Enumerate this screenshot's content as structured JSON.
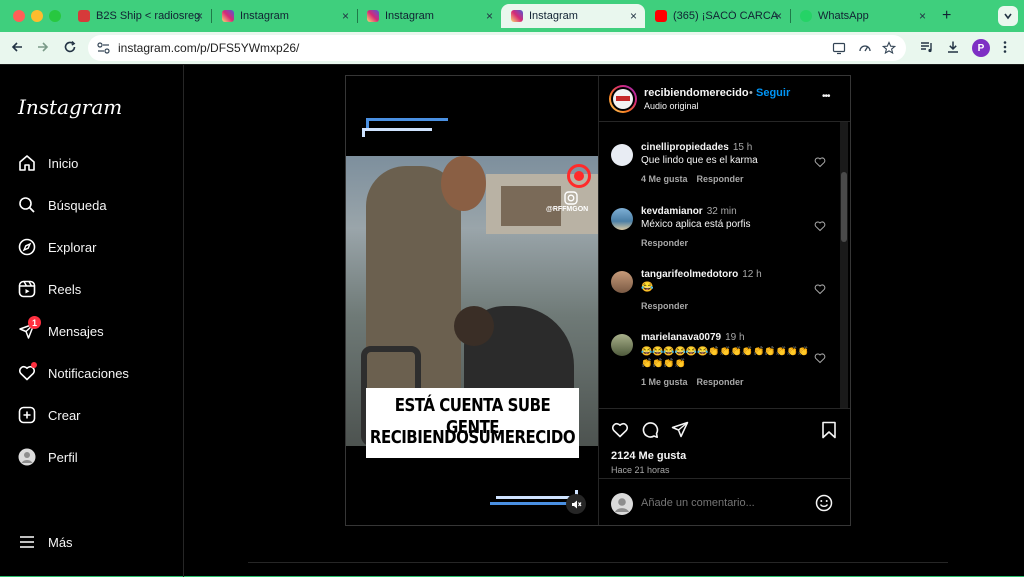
{
  "browser": {
    "tabs": [
      {
        "label": "B2S Ship < radiosreg",
        "favicon_color": "#d63a3a"
      },
      {
        "label": "Instagram",
        "favicon_color": "#d62976"
      },
      {
        "label": "Instagram",
        "favicon_color": "#d62976"
      },
      {
        "label": "Instagram",
        "favicon_color": "#d62976",
        "active": true
      },
      {
        "label": "(365) ¡SACÓ CARCA",
        "favicon_color": "#ff0000"
      },
      {
        "label": "WhatsApp",
        "favicon_color": "#25d366"
      }
    ],
    "new_tab": "+",
    "close_glyph": "×",
    "url": "instagram.com/p/DFS5YWmxp26/",
    "profile_initial": "P"
  },
  "sidebar": {
    "logo": "Instagram",
    "items": [
      {
        "label": "Inicio",
        "icon": "home-icon"
      },
      {
        "label": "Búsqueda",
        "icon": "search-icon"
      },
      {
        "label": "Explorar",
        "icon": "compass-icon"
      },
      {
        "label": "Reels",
        "icon": "reels-icon"
      },
      {
        "label": "Mensajes",
        "icon": "messenger-icon",
        "badge": "1"
      },
      {
        "label": "Notificaciones",
        "icon": "heart-icon"
      },
      {
        "label": "Crear",
        "icon": "plus-square-icon"
      },
      {
        "label": "Perfil",
        "icon": "avatar-icon"
      }
    ],
    "more": "Más"
  },
  "post": {
    "caption_line1": "ESTÁ CUENTA SUBE GENTE",
    "caption_line2": "RECIBIENDOSUMERECIDO",
    "watermark": "@RFFMGON",
    "header": {
      "username": "recibiendomerecido",
      "follow": "Seguir",
      "audio": "Audio original",
      "more": "•••"
    },
    "comments": [
      {
        "user": "cinellipropiedades",
        "time": "15 h",
        "text": "Que lindo que es el karma",
        "likes": "4 Me gusta",
        "reply": "Responder",
        "avatar_color": "#e8ecf3"
      },
      {
        "user": "kevdamianor",
        "time": "32 min",
        "text": "México aplica está porfis",
        "likes": "",
        "reply": "Responder",
        "avatar_color": "#5a86a8"
      },
      {
        "user": "tangarifeolmedotoro",
        "time": "12 h",
        "text": "😂",
        "likes": "",
        "reply": "Responder",
        "avatar_color": "#8a6b55"
      },
      {
        "user": "marielanava0079",
        "time": "19 h",
        "text": "😂😂😂😂😂😂👏👏👏👏👏👏👏👏👏👏👏👏👏",
        "likes": "1 Me gusta",
        "reply": "Responder",
        "avatar_color": "#6f7a58"
      }
    ],
    "likes_count": "2124 Me gusta",
    "posted": "Hace 21 horas",
    "add_comment_placeholder": "Añade un comentario..."
  }
}
